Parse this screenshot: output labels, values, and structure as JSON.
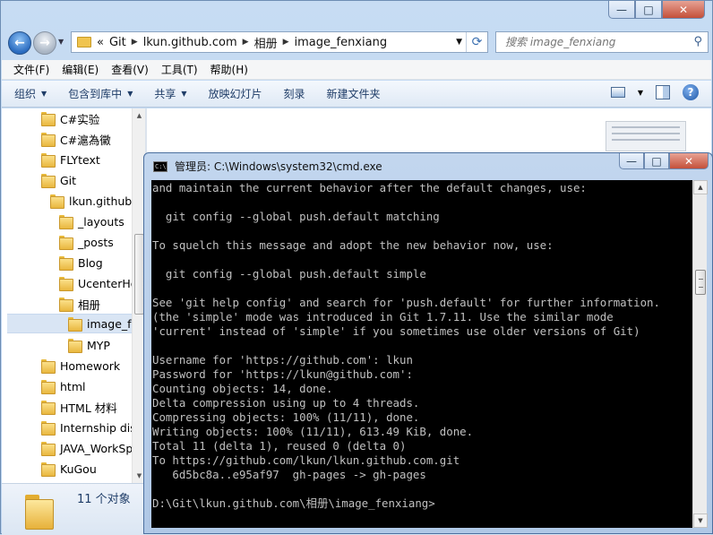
{
  "explorer": {
    "window_controls": {
      "minimize": "—",
      "maximize": "□",
      "close": "✕"
    },
    "nav": {
      "back": "←",
      "forward": "→"
    },
    "address": {
      "prefix": "«",
      "crumbs": [
        "Git",
        "lkun.github.com",
        "相册",
        "image_fenxiang"
      ]
    },
    "search": {
      "placeholder": "搜索 image_fenxiang"
    },
    "menu": [
      "文件(F)",
      "编辑(E)",
      "查看(V)",
      "工具(T)",
      "帮助(H)"
    ],
    "toolbar": {
      "items": [
        {
          "label": "组织",
          "dropdown": true
        },
        {
          "label": "包含到库中",
          "dropdown": true
        },
        {
          "label": "共享",
          "dropdown": true
        },
        {
          "label": "放映幻灯片",
          "dropdown": false
        },
        {
          "label": "刻录",
          "dropdown": false
        },
        {
          "label": "新建文件夹",
          "dropdown": false
        }
      ],
      "help": "?"
    },
    "tree": [
      {
        "label": "C#实验",
        "level": 0
      },
      {
        "label": "C#滬為黴",
        "level": 0
      },
      {
        "label": "FLYtext",
        "level": 0
      },
      {
        "label": "Git",
        "level": 0
      },
      {
        "label": "lkun.github.c",
        "level": 1
      },
      {
        "label": "_layouts",
        "level": 2
      },
      {
        "label": "_posts",
        "level": 2
      },
      {
        "label": "Blog",
        "level": 2
      },
      {
        "label": "UcenterHo",
        "level": 2
      },
      {
        "label": "相册",
        "level": 2
      },
      {
        "label": "image_fe",
        "level": 3,
        "selected": true
      },
      {
        "label": "MYP",
        "level": 3
      },
      {
        "label": "Homework",
        "level": 0
      },
      {
        "label": "html",
        "level": 0
      },
      {
        "label": "HTML 材料",
        "level": 0
      },
      {
        "label": "Internship dis",
        "level": 0
      },
      {
        "label": "JAVA_WorkSp",
        "level": 0
      },
      {
        "label": "KuGou",
        "level": 0
      }
    ],
    "status": {
      "count_text": "11 个对象"
    }
  },
  "cmd": {
    "title": "管理员: C:\\Windows\\system32\\cmd.exe",
    "icon_text": "C:\\",
    "lines": [
      "and maintain the current behavior after the default changes, use:",
      "",
      "  git config --global push.default matching",
      "",
      "To squelch this message and adopt the new behavior now, use:",
      "",
      "  git config --global push.default simple",
      "",
      "See 'git help config' and search for 'push.default' for further information.",
      "(the 'simple' mode was introduced in Git 1.7.11. Use the similar mode",
      "'current' instead of 'simple' if you sometimes use older versions of Git)",
      "",
      "Username for 'https://github.com': lkun",
      "Password for 'https://lkun@github.com':",
      "Counting objects: 14, done.",
      "Delta compression using up to 4 threads.",
      "Compressing objects: 100% (11/11), done.",
      "Writing objects: 100% (11/11), 613.49 KiB, done.",
      "Total 11 (delta 1), reused 0 (delta 0)",
      "To https://github.com/lkun/lkun.github.com.git",
      "   6d5bc8a..e95af97  gh-pages -> gh-pages",
      "",
      "D:\\Git\\lkun.github.com\\相册\\image_fenxiang>"
    ]
  }
}
